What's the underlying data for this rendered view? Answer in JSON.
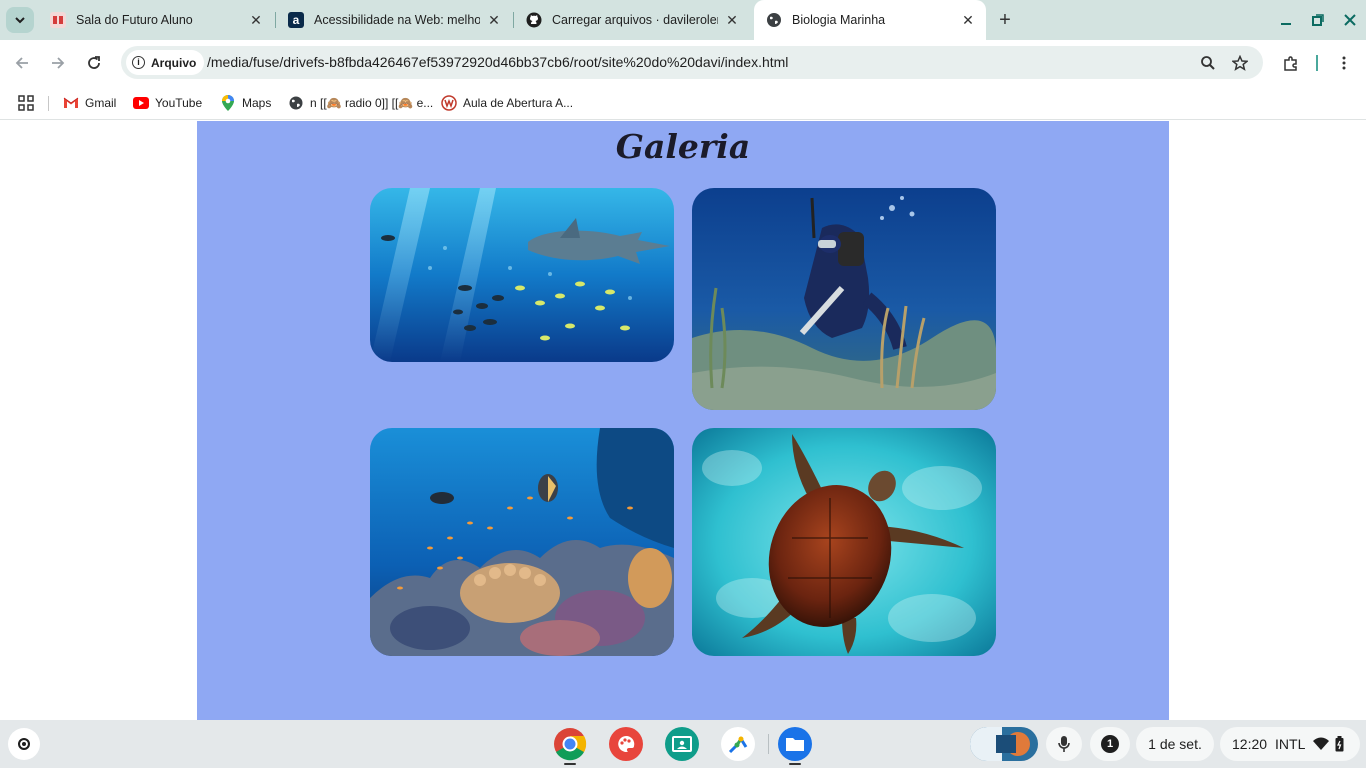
{
  "browser": {
    "tabs": [
      {
        "title": "Sala do Futuro Aluno",
        "favicon": "sala-do-futuro-icon",
        "active": false
      },
      {
        "title": "Acessibilidade na Web: melhor",
        "favicon": "alura-icon",
        "active": false
      },
      {
        "title": "Carregar arquivos · davilerolero",
        "favicon": "github-icon",
        "active": false
      },
      {
        "title": "Biologia Marinha",
        "favicon": "globe-icon",
        "active": true
      }
    ],
    "close_glyph": "✕",
    "new_tab_glyph": "+",
    "address": {
      "chip_label": "Arquivo",
      "url": "/media/fuse/drivefs-b8fbda426467ef53972920d46bb37cb6/root/site%20do%20davi/index.html"
    },
    "bookmarks": [
      {
        "label": "Gmail",
        "icon": "gmail-icon"
      },
      {
        "label": "YouTube",
        "icon": "youtube-icon"
      },
      {
        "label": "Maps",
        "icon": "maps-icon"
      },
      {
        "label": "n [[🙈 radio 0]] [[🙈 e...",
        "icon": "globe-icon"
      },
      {
        "label": "Aula de Abertura A...",
        "icon": "aula-icon"
      }
    ]
  },
  "page": {
    "title": "Galeria",
    "photos": [
      {
        "subject": "whale-shark-with-fish"
      },
      {
        "subject": "scuba-diver-on-reef"
      },
      {
        "subject": "coral-reef-with-fish"
      },
      {
        "subject": "sea-turtle"
      }
    ]
  },
  "shelf": {
    "apps": [
      "chrome-icon",
      "canvas-icon",
      "classroom-icon",
      "drawing-app-icon",
      "files-icon"
    ],
    "notification_count": "1",
    "date": "1 de set.",
    "time": "12:20",
    "input_method": "INTL"
  },
  "colors": {
    "tabstrip": "#d3e3e0",
    "page_background": "#8fa8f3",
    "shelf": "#e4e8ea"
  }
}
